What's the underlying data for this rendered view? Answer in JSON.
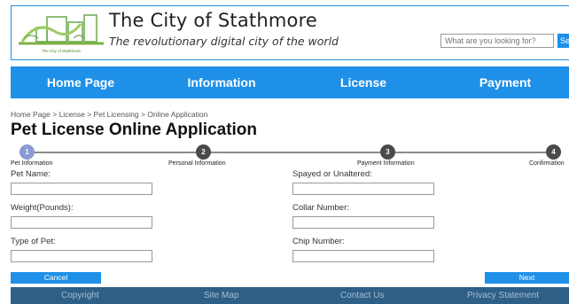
{
  "header": {
    "site_title": "The City of Stathmore",
    "tagline": "The revolutionary digital city of the world",
    "logo_text": "The City of Stathmore",
    "search": {
      "placeholder": "What are you looking for?",
      "button_label": "Search"
    }
  },
  "nav": {
    "items": [
      {
        "label": "Home Page"
      },
      {
        "label": "Information"
      },
      {
        "label": "License"
      },
      {
        "label": "Payment"
      }
    ]
  },
  "breadcrumb": "Home Page > License > Pet Licensing > Online Application",
  "page_title": "Pet License Online Application",
  "steps": [
    {
      "number": "1",
      "label": "Pet Information",
      "active": true
    },
    {
      "number": "2",
      "label": "Personal Information",
      "active": false
    },
    {
      "number": "3",
      "label": "Payment Information",
      "active": false
    },
    {
      "number": "4",
      "label": "Confirmation",
      "active": false
    }
  ],
  "form": {
    "left": [
      {
        "label": "Pet Name:",
        "value": ""
      },
      {
        "label": "Weight(Pounds):",
        "value": ""
      },
      {
        "label": "Type of Pet:",
        "value": ""
      }
    ],
    "right": [
      {
        "label": "Spayed or Unaltered:",
        "value": ""
      },
      {
        "label": "Collar Number:",
        "value": ""
      },
      {
        "label": "Chip Number:",
        "value": ""
      }
    ]
  },
  "buttons": {
    "cancel": "Cancel",
    "next": "Next"
  },
  "footer": {
    "links": [
      {
        "label": "Copyright"
      },
      {
        "label": "Site Map"
      },
      {
        "label": "Contact Us"
      },
      {
        "label": "Privacy Statement"
      }
    ]
  },
  "colors": {
    "accent": "#1e90e8",
    "footer_bg": "#2e5f86",
    "step_active": "#8a9bd3",
    "step_inactive": "#4a4a4a"
  }
}
